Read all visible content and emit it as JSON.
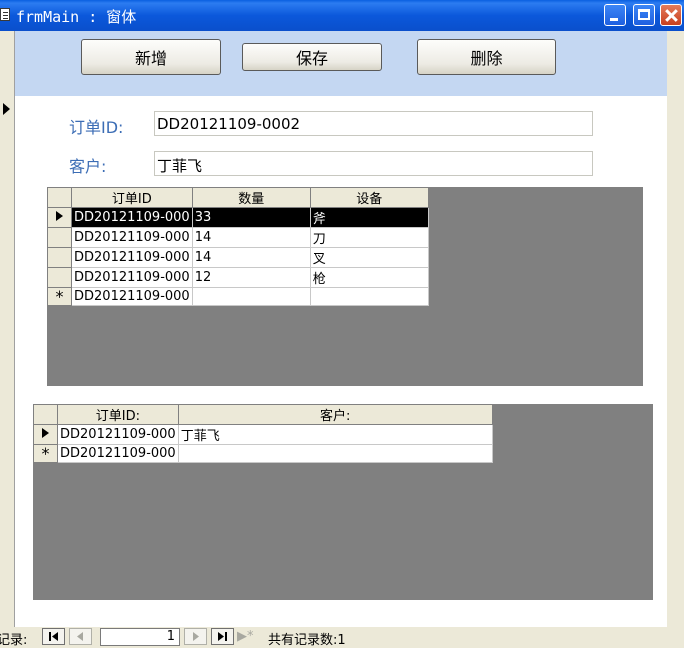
{
  "window": {
    "title": "frmMain : 窗体"
  },
  "toolbar": {
    "new_label": "新增",
    "save_label": "保存",
    "delete_label": "删除"
  },
  "form": {
    "order_id_label": "订单ID:",
    "order_id_value": "DD20121109-0002",
    "customer_label": "客户:",
    "customer_value": "丁菲飞"
  },
  "subform1": {
    "columns": [
      "订单ID",
      "数量",
      "设备"
    ],
    "rows": [
      [
        "DD20121109-000",
        "33",
        "斧"
      ],
      [
        "DD20121109-000",
        "14",
        "刀"
      ],
      [
        "DD20121109-000",
        "14",
        "叉"
      ],
      [
        "DD20121109-000",
        "12",
        "枪"
      ]
    ],
    "new_row": [
      "DD20121109-000",
      "",
      ""
    ]
  },
  "subform2": {
    "columns": [
      "订单ID:",
      "客户:"
    ],
    "rows": [
      [
        "DD20121109-000",
        "丁菲飞"
      ]
    ],
    "new_row": [
      "DD20121109-000",
      ""
    ]
  },
  "navigation": {
    "label": "记录:",
    "current": "1",
    "total_text": "共有记录数:1",
    "new_record_glyph": "▶*"
  }
}
